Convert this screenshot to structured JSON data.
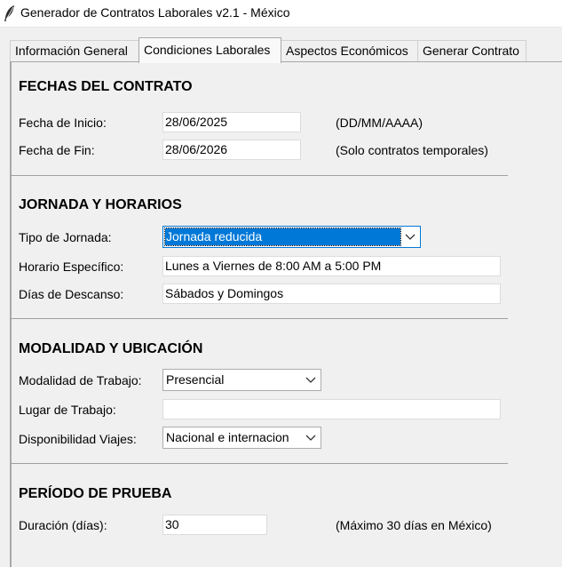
{
  "window": {
    "title": "Generador de Contratos Laborales v2.1 - México"
  },
  "tabs": [
    {
      "label": "Información General"
    },
    {
      "label": "Condiciones Laborales"
    },
    {
      "label": "Aspectos Económicos"
    },
    {
      "label": "Generar Contrato"
    }
  ],
  "active_tab": "Condiciones Laborales",
  "fechas": {
    "title": "FECHAS DEL CONTRATO",
    "inicio_label": "Fecha de Inicio:",
    "inicio_value": "28/06/2025",
    "inicio_hint": "(DD/MM/AAAA)",
    "fin_label": "Fecha de Fin:",
    "fin_value": "28/06/2026",
    "fin_hint": "(Solo contratos temporales)"
  },
  "jornada": {
    "title": "JORNADA Y HORARIOS",
    "tipo_label": "Tipo de Jornada:",
    "tipo_value": "Jornada reducida",
    "horario_label": "Horario Específico:",
    "horario_value": "Lunes a Viernes de 8:00 AM a 5:00 PM",
    "descanso_label": "Días de Descanso:",
    "descanso_value": "Sábados y Domingos"
  },
  "modalidad": {
    "title": "MODALIDAD Y UBICACIÓN",
    "modalidad_label": "Modalidad de Trabajo:",
    "modalidad_value": "Presencial",
    "lugar_label": "Lugar de Trabajo:",
    "lugar_value": "",
    "viajes_label": "Disponibilidad Viajes:",
    "viajes_value": "Nacional e internacion"
  },
  "prueba": {
    "title": "PERÍODO DE PRUEBA",
    "duracion_label": "Duración (días):",
    "duracion_value": "30",
    "duracion_hint": "(Máximo 30 días en México)"
  },
  "colors": {
    "accent": "#0078d7",
    "background": "#f0f0f0"
  },
  "icons": {
    "app": "feather-icon",
    "dropdown": "chevron-down-icon"
  }
}
